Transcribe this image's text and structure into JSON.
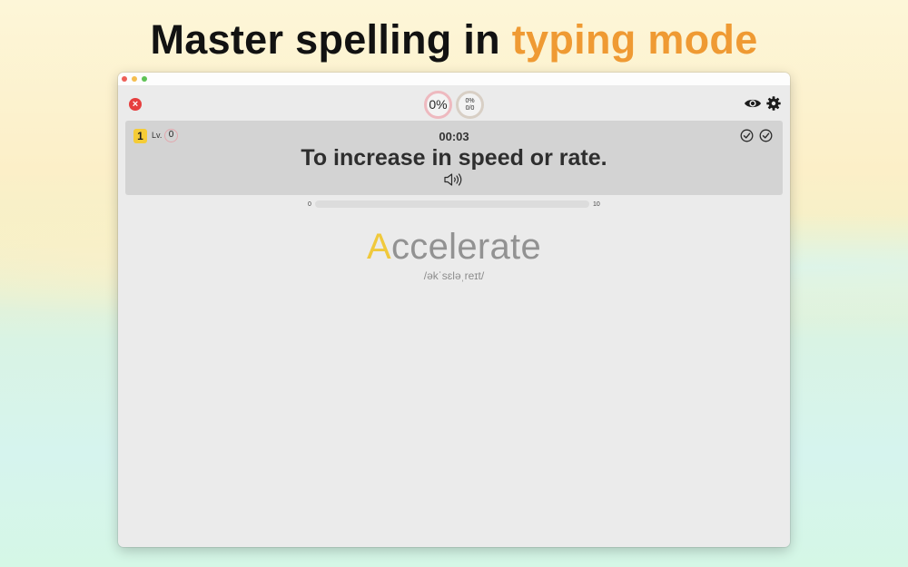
{
  "headline": {
    "main": "Master spelling in",
    "accent": "typing mode"
  },
  "toolbar": {
    "accuracy_ring": "0%",
    "stats_ring": {
      "percent": "0%",
      "fraction": "0/0"
    },
    "icons": [
      "close-icon",
      "eye-icon",
      "gear-icon"
    ]
  },
  "card": {
    "level_badge": "1",
    "level_label": "Lv.",
    "level_value": "0",
    "timer": "00:03",
    "definition": "To increase in speed or rate.",
    "icons": [
      "check-circle-icon",
      "check-circle-icon",
      "speaker-icon"
    ]
  },
  "progress": {
    "min": "0",
    "max": "10",
    "value": 0
  },
  "word": {
    "typed": "A",
    "remaining": "ccelerate",
    "phonetic": "/əkˈsɛləˌreɪt/"
  },
  "colors": {
    "accent": "#ef9a33",
    "typed_letter": "#f0c93c",
    "close_button": "#e63e3e",
    "level_badge": "#f5cc36"
  }
}
